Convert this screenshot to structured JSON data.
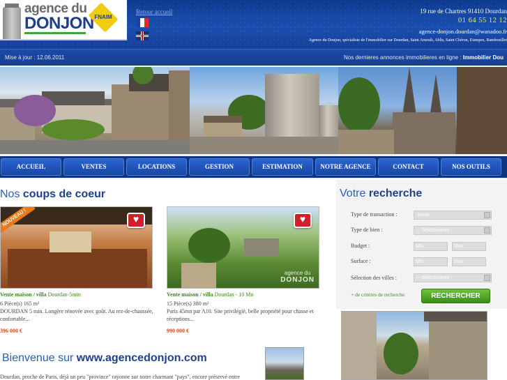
{
  "header": {
    "logo_line1": "agence du",
    "logo_line2": "DONJON",
    "fnaim": "FNAIM",
    "retour": "Retour accueil",
    "address": "19 rue de Chartres 91410 Dourdan",
    "phone": "01 64 55 12 12",
    "email": "agence-donjon.dourdan@wanadoo.fr",
    "tagline": "Agence du Donjon, spécialiste de l'immobilier sur Dourdan, Saint Arnoult, Ablis, Saint Chéron, Etampes, Rambouillet",
    "languages": [
      "fr",
      "en"
    ]
  },
  "updatebar": {
    "maj": "Mise à jour : 12.06.2011",
    "dernieres": "Nos dernieres annonces immobilieres en ligne :",
    "dernieres_bold": "Immobilier Dou"
  },
  "nav": [
    "ACCUEIL",
    "VENTES",
    "LOCATIONS",
    "GESTION",
    "ESTIMATION",
    "NOTRE AGENCE",
    "CONTACT",
    "NOS OUTILS"
  ],
  "coups": {
    "title_light": "Nos",
    "title_bold": "coups de coeur",
    "badge": "NOUVEAU !",
    "watermark1": "agence du",
    "watermark2": "DONJON",
    "properties": [
      {
        "type": "Vente maison / villa",
        "place": "Dourdan-5min",
        "details": "6 Pièce(s) 165 m²",
        "desc": "DOURDAN 5 min. Longère rénovée avec goût. Au rez-de-chaussée, confortable...",
        "price": "396 000 €"
      },
      {
        "type": "Vente maison / villa",
        "place": "Dourdan - 10 Mn",
        "details": "15 Pièce(s) 380 m²",
        "desc": "Paris 45mn par A10. Site privilégié, belle propriété pour chasse et réceptions...",
        "price": "990 000 €"
      }
    ]
  },
  "welcome": {
    "title_light": "Bienvenue sur",
    "title_bold": "www.agencedonjon.com",
    "text": "Dourdan, proche de Paris, déjà un peu \"province\" rayonne sur notre charmant \"pays\", encore préservé entre"
  },
  "search": {
    "title_light": "Votre",
    "title_bold": "recherche",
    "transaction_label": "Type de transaction :",
    "transaction_value": "Vente",
    "bien_label": "Type de bien :",
    "bien_value": "-- Sélectionnez --",
    "budget_label": "Budget :",
    "surface_label": "Surface :",
    "villes_label": "Sélection des villes :",
    "villes_value": "-- Sélectionnez --",
    "min_placeholder": "Min",
    "max_placeholder": "Max",
    "criteres": "+ de critères de recherche",
    "button": "RECHERCHER"
  },
  "colors": {
    "header": "#1a4fb0",
    "accent_green": "#3c8a1c",
    "price": "#d34a16",
    "title_blue": "#245fbf"
  }
}
